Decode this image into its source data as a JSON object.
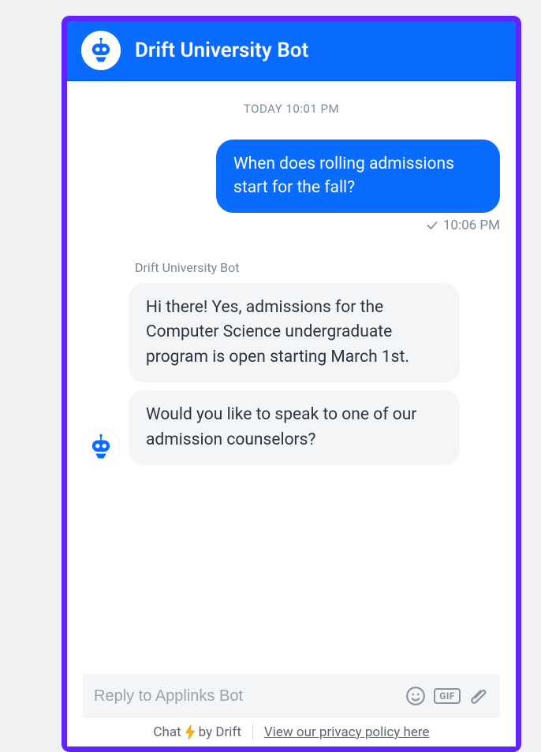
{
  "header": {
    "title": "Drift University Bot"
  },
  "timeline": {
    "header_timestamp": "TODAY 10:01 PM",
    "user_message": "When does rolling admissions start for the fall?",
    "sent_time": "10:06 PM",
    "bot_sender_label": "Drift University Bot",
    "bot_msg_1": "Hi there! Yes, admissions for the Computer Science undergraduate program is open starting March 1st.",
    "bot_msg_2": "Would you like to speak to one of our admission counselors?"
  },
  "composer": {
    "placeholder": "Reply to Applinks Bot",
    "gif_label": "GIF"
  },
  "footer": {
    "chat_prefix": "Chat",
    "chat_suffix": "by Drift",
    "privacy": "View our privacy policy here"
  },
  "icons": {
    "bot": "robot-icon",
    "check": "checkmark-icon",
    "emoji": "smiley-icon",
    "gif": "gif-icon",
    "attach": "paperclip-icon",
    "bolt": "lightning-icon"
  }
}
